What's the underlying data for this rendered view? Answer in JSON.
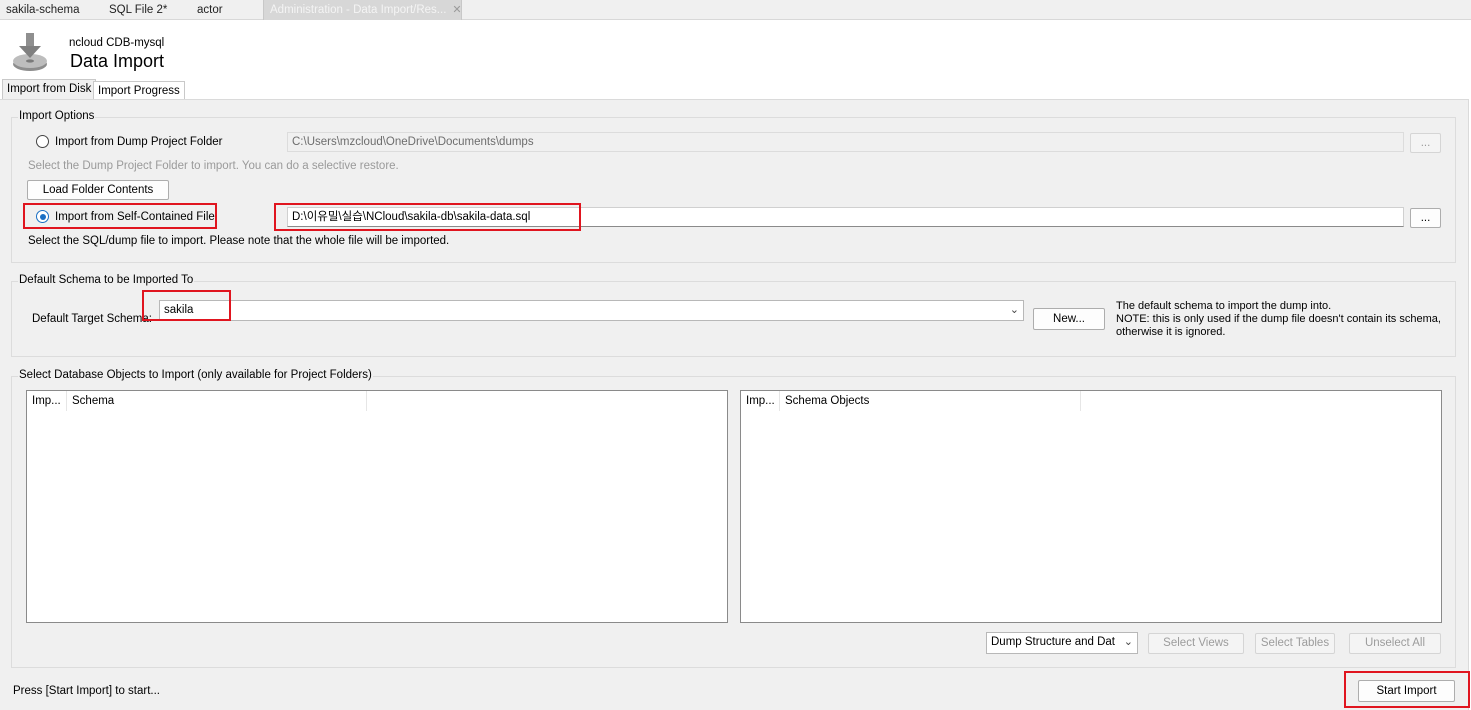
{
  "tabs": [
    {
      "label": "sakila-schema"
    },
    {
      "label": "SQL File 2*"
    },
    {
      "label": "actor"
    },
    {
      "label": "Administration - Data Import/Res..."
    }
  ],
  "header": {
    "connection": "ncloud CDB-mysql",
    "title": "Data Import"
  },
  "subtabs": {
    "import_from_disk": "Import from Disk",
    "import_progress": "Import Progress"
  },
  "import_options": {
    "group_label": "Import Options",
    "dump_folder": {
      "label": "Import from Dump Project Folder",
      "path": "C:\\Users\\mzcloud\\OneDrive\\Documents\\dumps",
      "hint": "Select the Dump Project Folder to import. You can do a selective restore.",
      "browse": "..."
    },
    "load_folder_button": "Load Folder Contents",
    "self_contained": {
      "label": "Import from Self-Contained File",
      "path": "D:\\이유밀\\실습\\NCloud\\sakila-db\\sakila-data.sql",
      "hint": "Select the SQL/dump file to import. Please note that the whole file will be imported.",
      "browse": "..."
    }
  },
  "default_schema": {
    "group_label": "Default Schema to be Imported To",
    "target_label": "Default Target Schema:",
    "selected": "sakila",
    "new_button": "New...",
    "note": [
      "The default schema to import the dump into.",
      "NOTE: this is only used if the dump file doesn't contain its schema,",
      "otherwise it is ignored."
    ]
  },
  "objects": {
    "group_label": "Select Database Objects to Import (only available for Project Folders)",
    "left_columns": [
      "Imp...",
      "Schema"
    ],
    "right_columns": [
      "Imp...",
      "Schema Objects"
    ],
    "dump_select": "Dump Structure and Dat",
    "select_views": "Select Views",
    "select_tables": "Select Tables",
    "unselect_all": "Unselect All"
  },
  "footer": {
    "status": "Press [Start Import] to start...",
    "start_button": "Start Import"
  },
  "colors": {
    "highlight": "#e0151f",
    "radio_accent": "#1a6fc4",
    "panel_bg": "#f0f0f0"
  }
}
